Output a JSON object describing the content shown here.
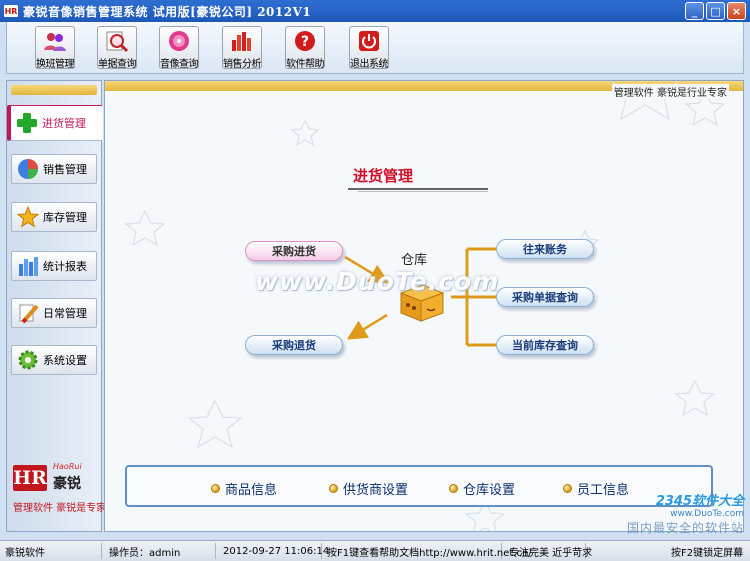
{
  "window": {
    "title": "豪锐音像销售管理系统  试用版[豪锐公司]  2012V1",
    "icon_text": "HR",
    "minimize": "_",
    "maximize": "□",
    "close": "×"
  },
  "toolbar": {
    "buttons": [
      {
        "label": "换班管理",
        "icon": "users-icon"
      },
      {
        "label": "单据查询",
        "icon": "magnifier-icon"
      },
      {
        "label": "音像查询",
        "icon": "disc-icon"
      },
      {
        "label": "销售分析",
        "icon": "bar-chart-icon"
      },
      {
        "label": "软件帮助",
        "icon": "help-icon"
      },
      {
        "label": "退出系统",
        "icon": "power-icon"
      }
    ]
  },
  "sidebar": {
    "items": [
      {
        "label": "进货管理",
        "icon": "plus-icon",
        "active": true
      },
      {
        "label": "销售管理",
        "icon": "pie-chart-icon"
      },
      {
        "label": "库存管理",
        "icon": "star-icon"
      },
      {
        "label": "统计报表",
        "icon": "report-icon"
      },
      {
        "label": "日常管理",
        "icon": "brush-icon"
      },
      {
        "label": "系统设置",
        "icon": "gear-icon"
      }
    ],
    "logo": {
      "mark": "HR",
      "en": "HaoRui",
      "cn": "豪锐",
      "slogan": "管理软件 豪锐是专家"
    }
  },
  "main": {
    "tagline": "管理软件 豪锐是行业专家",
    "page_title": "进货管理",
    "warehouse_label": "仓库",
    "watermark": "www.DuoTe.com",
    "left_actions": [
      "采购进货",
      "采购退货"
    ],
    "right_actions": [
      "往来账务",
      "采购单据查询",
      "当前库存查询"
    ],
    "bottom_links": [
      "商品信息",
      "供货商设置",
      "仓库设置",
      "员工信息"
    ]
  },
  "statusbar": {
    "company": "豪锐软件",
    "operator": "操作员：admin",
    "datetime": "2012-09-27 11:06:14",
    "help": "按F1键查看帮助文档http://www.hrit.net.cn/",
    "slogan": "专注完美 近乎苛求",
    "lock": "按F2键锁定屏幕"
  },
  "corner_watermark": {
    "brand": "2345软件大全",
    "url": "www.DuoTe.com",
    "tag": "国内最安全的软件站"
  },
  "colors": {
    "title_bar": "#2f6fd2",
    "active_accent": "#c2185b",
    "page_title": "#d0102a",
    "connector": "#e09a1a",
    "panel_border": "#5f8fc9"
  }
}
